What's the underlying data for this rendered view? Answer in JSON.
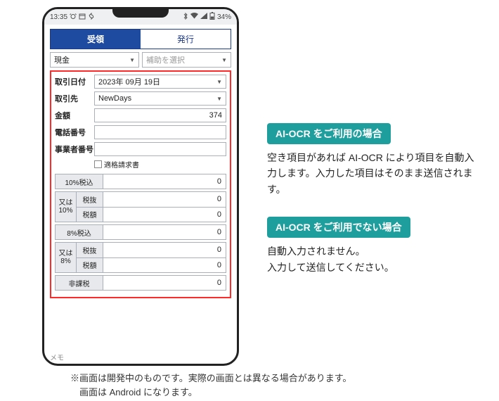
{
  "statusbar": {
    "time": "13:35",
    "battery": "34%"
  },
  "tabs": {
    "receive": "受領",
    "issue": "発行"
  },
  "selects": {
    "payment": "現金",
    "sub_placeholder": "補助を選択"
  },
  "form": {
    "date_label": "取引日付",
    "date_value": "2023年 09月 19日",
    "partner_label": "取引先",
    "partner_value": "NewDays",
    "amount_label": "金額",
    "amount_value": "374",
    "phone_label": "電話番号",
    "phone_value": "",
    "bizno_label": "事業者番号",
    "bizno_value": "",
    "qualified_label": "適格請求書"
  },
  "tax": {
    "t10inc_label": "10%税込",
    "t10inc_value": "0",
    "or10_label_a": "又は",
    "or10_label_b": "10%",
    "excl_label": "税抜",
    "tax_label": "税額",
    "t10excl_value": "0",
    "t10tax_value": "0",
    "t8inc_label": "8%税込",
    "t8inc_value": "0",
    "or8_label_a": "又は",
    "or8_label_b": "8%",
    "t8excl_value": "0",
    "t8tax_value": "0",
    "nontax_label": "非課税",
    "nontax_value": "0"
  },
  "memo": "メモ",
  "callouts": {
    "c1_title": "AI-OCR をご利用の場合",
    "c1_body": "空き項目があれば AI-OCR により項目を自動入力します。入力した項目はそのまま送信されます。",
    "c2_title": "AI-OCR をご利用でない場合",
    "c2_body": "自動入力されません。\n入力して送信してください。"
  },
  "footnote": "※画面は開発中のものです。実際の画面とは異なる場合があります。\n　画面は Android になります。"
}
